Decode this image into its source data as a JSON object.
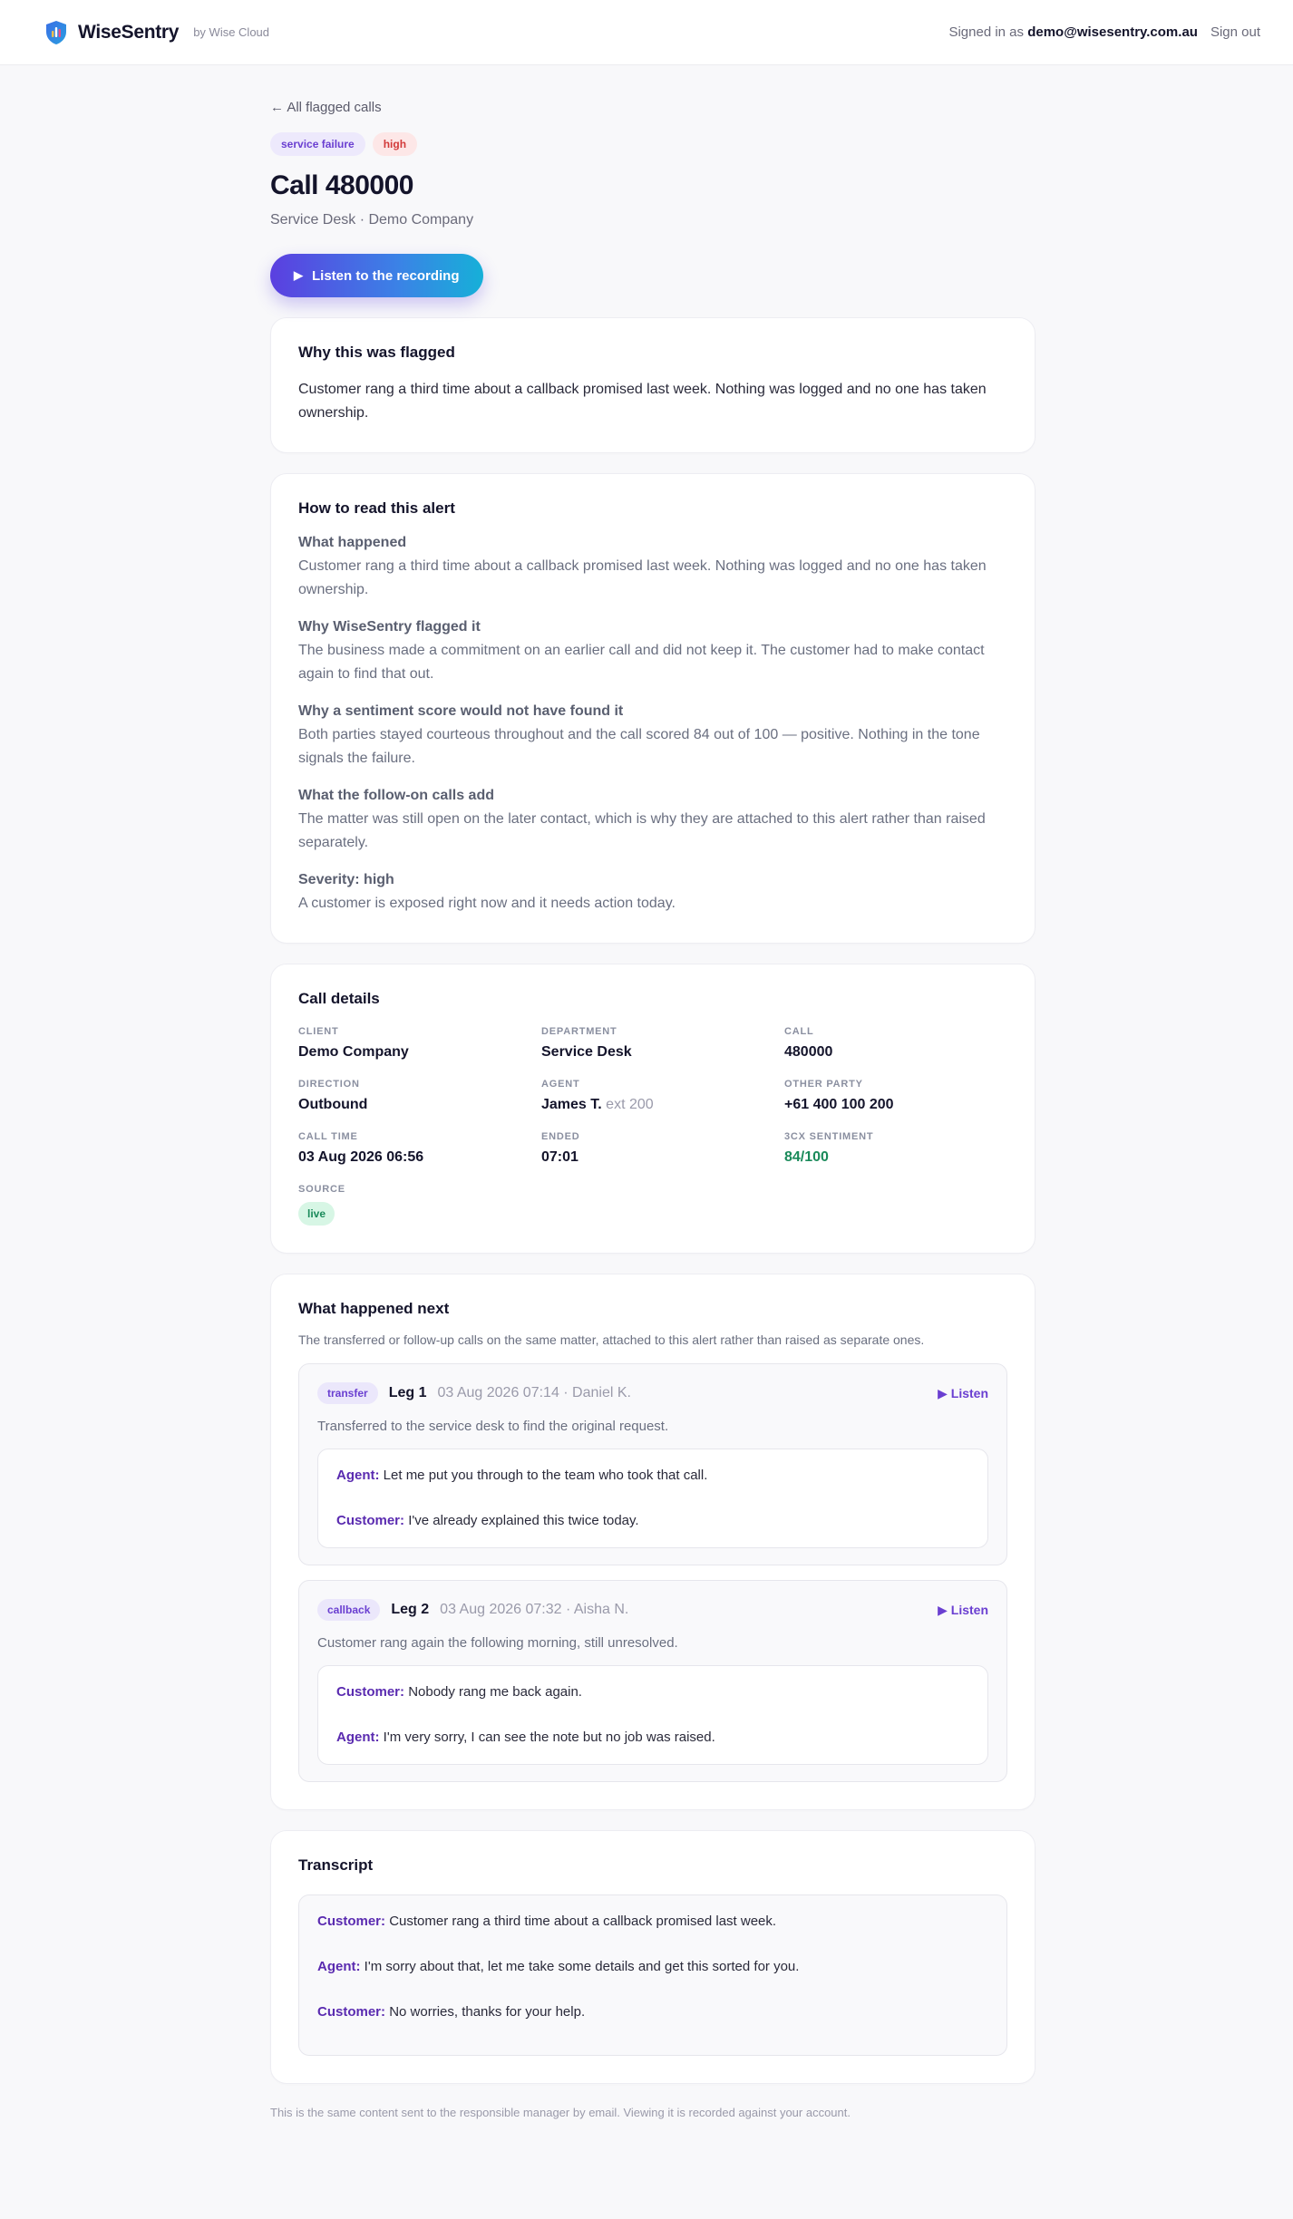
{
  "header": {
    "brand": "WiseSentry",
    "brand_sub": "by Wise Cloud",
    "signed_in_prefix": "Signed in as",
    "email": "demo@wisesentry.com.au",
    "sign_out": "Sign out"
  },
  "nav": {
    "back": "← All flagged calls"
  },
  "tags": {
    "type": "service failure",
    "severity": "high"
  },
  "call": {
    "title": "Call 480000",
    "subtitle": "Service Desk · Demo Company",
    "listen_label": "Listen to the recording"
  },
  "why": {
    "title": "Why this was flagged",
    "text": "Customer rang a third time about a callback promised last week. Nothing was logged and no one has taken ownership."
  },
  "how": {
    "title": "How to read this alert",
    "items": [
      {
        "heading": "What happened",
        "text": "Customer rang a third time about a callback promised last week. Nothing was logged and no one has taken ownership."
      },
      {
        "heading": "Why WiseSentry flagged it",
        "text": "The business made a commitment on an earlier call and did not keep it. The customer had to make contact again to find that out."
      },
      {
        "heading": "Why a sentiment score would not have found it",
        "text": "Both parties stayed courteous throughout and the call scored 84 out of 100 — positive. Nothing in the tone signals the failure."
      },
      {
        "heading": "What the follow-on calls add",
        "text": "The matter was still open on the later contact, which is why they are attached to this alert rather than raised separately."
      },
      {
        "heading": "Severity: high",
        "text": "A customer is exposed right now and it needs action today."
      }
    ]
  },
  "details": {
    "title": "Call details",
    "client_label": "CLIENT",
    "client": "Demo Company",
    "department_label": "DEPARTMENT",
    "department": "Service Desk",
    "call_label": "CALL",
    "call": "480000",
    "direction_label": "DIRECTION",
    "direction": "Outbound",
    "agent_label": "AGENT",
    "agent": "James T.",
    "agent_ext": "ext 200",
    "other_party_label": "OTHER PARTY",
    "other_party": "+61 400 100 200",
    "call_time_label": "CALL TIME",
    "call_time": "03 Aug 2026 06:56",
    "ended_label": "ENDED",
    "ended": "07:01",
    "sentiment_label": "3CX SENTIMENT",
    "sentiment": "84/100",
    "source_label": "SOURCE",
    "source": "live"
  },
  "next": {
    "title": "What happened next",
    "description": "The transferred or follow-up calls on the same matter, attached to this alert rather than raised as separate ones.",
    "legs": [
      {
        "badge": "transfer",
        "leg": "Leg 1",
        "meta": "03 Aug 2026 07:14 · Daniel K.",
        "listen": "▶ Listen",
        "description": "Transferred to the service desk to find the original request.",
        "lines": [
          {
            "speaker": "Agent:",
            "text": "Let me put you through to the team who took that call."
          },
          {
            "speaker": "Customer:",
            "text": "I've already explained this twice today."
          }
        ]
      },
      {
        "badge": "callback",
        "leg": "Leg 2",
        "meta": "03 Aug 2026 07:32 · Aisha N.",
        "listen": "▶ Listen",
        "description": "Customer rang again the following morning, still unresolved.",
        "lines": [
          {
            "speaker": "Customer:",
            "text": "Nobody rang me back again."
          },
          {
            "speaker": "Agent:",
            "text": "I'm very sorry, I can see the note but no job was raised."
          }
        ]
      }
    ]
  },
  "transcript": {
    "title": "Transcript",
    "lines": [
      {
        "speaker": "Customer:",
        "text": "Customer rang a third time about a callback promised last week."
      },
      {
        "speaker": "Agent:",
        "text": "I'm sorry about that, let me take some details and get this sorted for you."
      },
      {
        "speaker": "Customer:",
        "text": "No worries, thanks for your help."
      }
    ]
  },
  "footer": {
    "note": "This is the same content sent to the responsible manager by email. Viewing it is recorded against your account."
  }
}
